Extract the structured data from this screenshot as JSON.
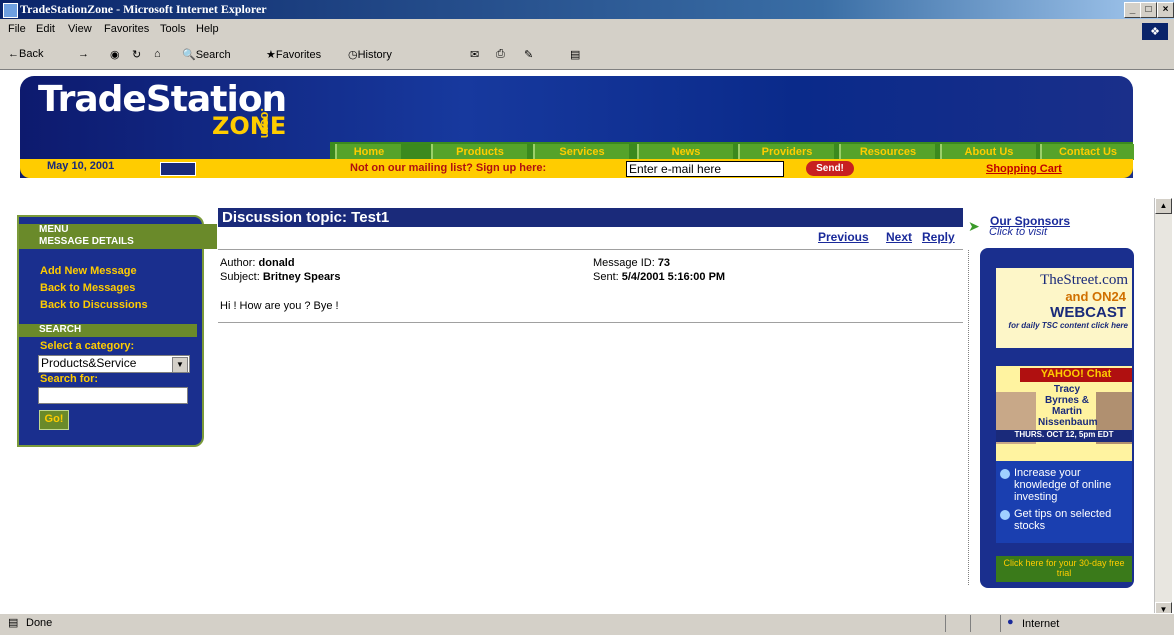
{
  "window": {
    "title": "TradeStationZone - Microsoft Internet Explorer",
    "minimize": "_",
    "maximize": "□",
    "close": "×"
  },
  "menu": [
    "File",
    "Edit",
    "View",
    "Favorites",
    "Tools",
    "Help"
  ],
  "toolbar": {
    "back": "←Back",
    "forward": "→",
    "stop_icon": "stop-icon",
    "refresh_icon": "refresh-icon",
    "home_icon": "home-icon",
    "search": "Search",
    "favorites": "Favorites",
    "history": "History"
  },
  "site": {
    "logo_main": "TradeStation",
    "logo_zone": "ZONE",
    "logo_com": ".com",
    "nav": [
      "Home",
      "Products",
      "Services",
      "News",
      "Providers",
      "Resources",
      "About Us",
      "Contact Us"
    ],
    "date": "May 10, 2001",
    "mailing_label": "Not on our mailing list? Sign up here:",
    "email_value": "Enter e-mail here",
    "send_label": "Send!",
    "cart_label": "Shopping Cart"
  },
  "leftmenu": {
    "menu_head1": "MENU",
    "menu_head2": "MESSAGE DETAILS",
    "links": [
      "Add New Message",
      "Back to Messages",
      "Back to Discussions"
    ],
    "search_head": "SEARCH",
    "category_label": "Select a category:",
    "category_value": "Products&Service",
    "search_label": "Search for:",
    "go_label": "Go!"
  },
  "topic": {
    "title": "Discussion topic: Test1",
    "prev": "Previous",
    "next": "Next",
    "reply": "Reply",
    "author_label": "Author:",
    "author": "donald",
    "subject_label": "Subject:",
    "subject": "Britney Spears",
    "msgid_label": "Message ID:",
    "msgid": "73",
    "sent_label": "Sent:",
    "sent": "5/4/2001 5:16:00 PM",
    "body": "Hi ! How are you ? Bye !"
  },
  "sponsors": {
    "title": "Our Sponsors",
    "subtitle": "Click to visit",
    "ad1_l1": "TheStreet.com",
    "ad1_l2": "and ON24",
    "ad1_l3": "WEBCAST",
    "ad1_l4": "for daily TSC content click here",
    "ad2_brand": "YAHOO! Chat",
    "ad2_names": "Tracy Byrnes & Martin Nissenbaum",
    "ad2_date": "THURS. OCT 12, 5pm EDT",
    "ad3_l1": "Increase your knowledge of online investing",
    "ad3_l2": "Get tips on selected stocks",
    "ad4": "Click here for your 30-day free trial"
  },
  "status": {
    "text": "Done",
    "zone": "Internet"
  }
}
